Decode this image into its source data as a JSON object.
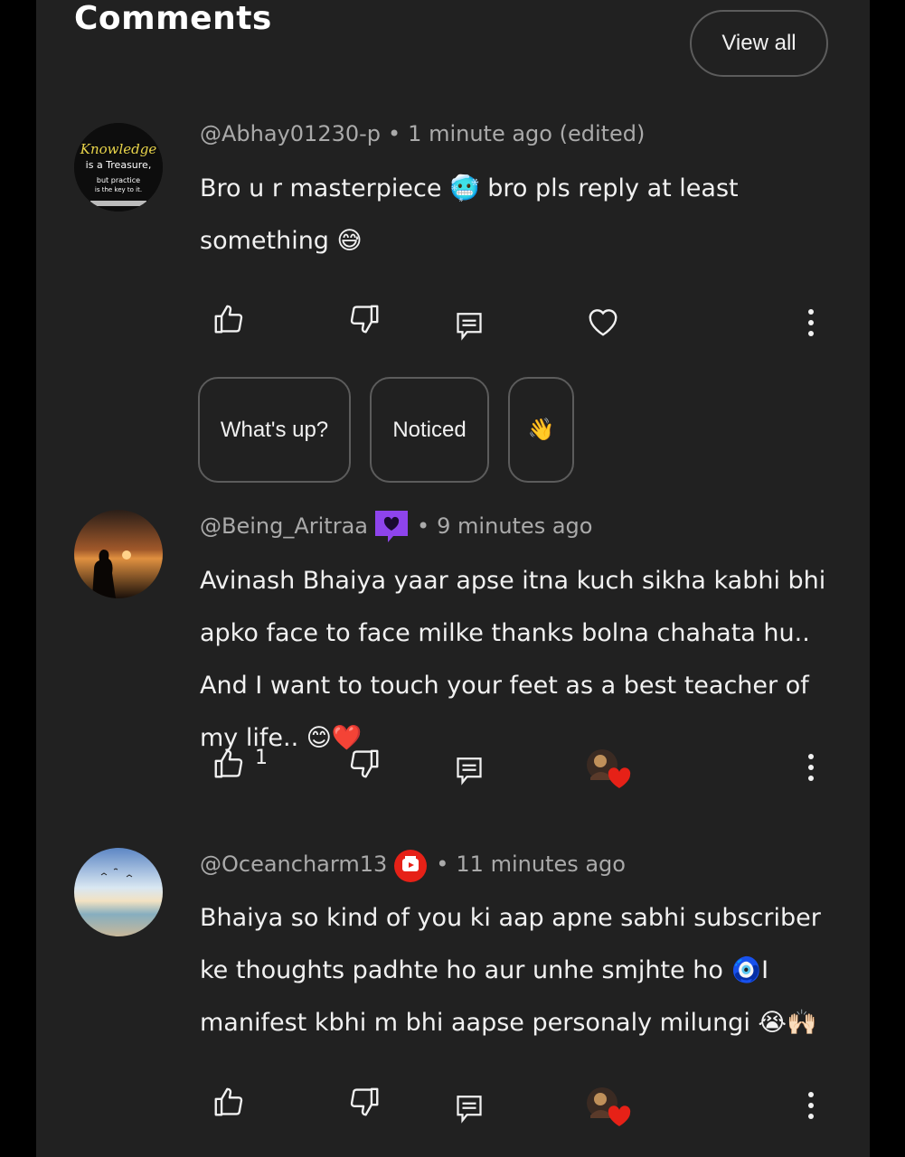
{
  "header": {
    "title": "Comments",
    "view_all_label": "View all"
  },
  "comments": [
    {
      "author": "@Abhay01230-p",
      "time": "1 minute ago (edited)",
      "text": "Bro u r masterpiece 🥶 bro pls reply at least something 😅",
      "like_count": "",
      "avatar_text": [
        "Knowledge",
        "is a Treasure,",
        "but practice",
        "is the key to it."
      ],
      "reply_chips": [
        "What's up?",
        "Noticed",
        "👋"
      ]
    },
    {
      "author": "@Being_Aritraa",
      "time": "9 minutes ago",
      "text": "Avinash Bhaiya yaar apse itna kuch sikha kabhi bhi apko face to face milke thanks bolna chahata hu.. And I want to touch your feet as a best teacher of my life.. 😊❤️",
      "like_count": "1",
      "badge": "member-heart-icon"
    },
    {
      "author": "@Oceancharm13",
      "time": "11 minutes ago",
      "text": "Bhaiya so kind of you ki aap apne sabhi subscriber ke thoughts padhte ho aur unhe smjhte ho 🧿I manifest kbhi m bhi aapse personaly milungi 😭🙌🏻",
      "like_count": "",
      "badge": "youtube-badge-icon"
    }
  ],
  "colors": {
    "background": "#212121",
    "text": "#f1f1f1",
    "muted": "#aaaaaa",
    "border": "#5c5c5c",
    "member_badge": "#8e44ec",
    "yt_red": "#e62117"
  }
}
